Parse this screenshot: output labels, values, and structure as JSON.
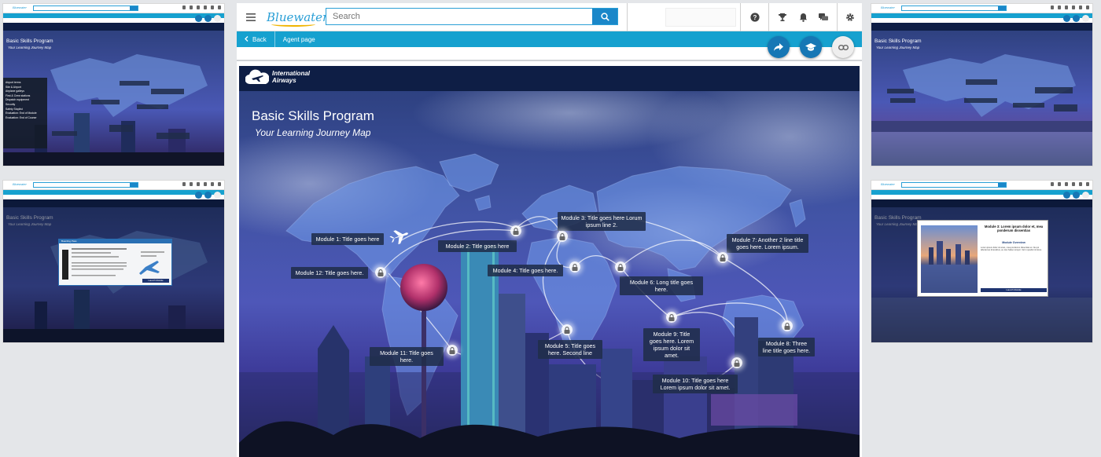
{
  "app": {
    "brand": "Bluewater",
    "search_placeholder": "Search",
    "back_label": "Back",
    "breadcrumb": "Agent page"
  },
  "course": {
    "logo_text": "International Airways",
    "title": "Basic Skills Program",
    "subtitle": "Your Learning Journey Map"
  },
  "modules": [
    {
      "text": "Module 1: Title goes here"
    },
    {
      "text": "Module 2: Title goes here"
    },
    {
      "text": "Module 3: Title goes here Lorum ipsum line 2."
    },
    {
      "text": "Module 4: Title goes here."
    },
    {
      "text": "Module 5: Title goes here. Second line"
    },
    {
      "text": "Module 6: Long title goes here."
    },
    {
      "text": "Module 7: Another 2 line title goes here. Lorem ipsum."
    },
    {
      "text": "Module 8: Three line title goes here."
    },
    {
      "text": "Module 9: Title goes here. Lorem ipsum dolor sit amet."
    },
    {
      "text": "Module 10: Title goes here Lorem ipsum dolor sit amet."
    },
    {
      "text": "Module 11: Title goes here."
    },
    {
      "text": "Module 12: Title goes here."
    }
  ],
  "thumb_menu": [
    "Airport terms",
    "Site & Airport",
    "Airplane galleys",
    "First & Crew stations",
    "Dispatch equipment",
    "Security",
    "Safety Stoplist",
    "Evaluation: End of Module",
    "Evaluation: End of Course"
  ],
  "thumb_modal": {
    "title": "Module 3: Lorem ipsum dolor et, mea ponderum dissentias",
    "overview_label": "Module Overview",
    "body": "Lorem ipsum dolor sit amet, mea ponderum dissentias ei. Ne qui laboramus forensibus, eu duo habeo tempor. Vel in quodsi inimicus.",
    "button": "Launch Module"
  },
  "thumb_ticket": {
    "header": "Boarding Pass",
    "button": "Launch Module"
  },
  "colors": {
    "accent": "#16a1cf",
    "brand_blue": "#2a9fd6",
    "fab_blue": "#1677b5",
    "course_header": "#0e1e45",
    "module_box": "#202d4a"
  },
  "icons": [
    "hamburger-icon",
    "search-icon",
    "help-icon",
    "trophy-icon",
    "bell-icon",
    "chat-icon",
    "gear-icon",
    "share-icon",
    "graduation-cap-icon",
    "link-icon",
    "lock-icon",
    "airplane-icon"
  ]
}
